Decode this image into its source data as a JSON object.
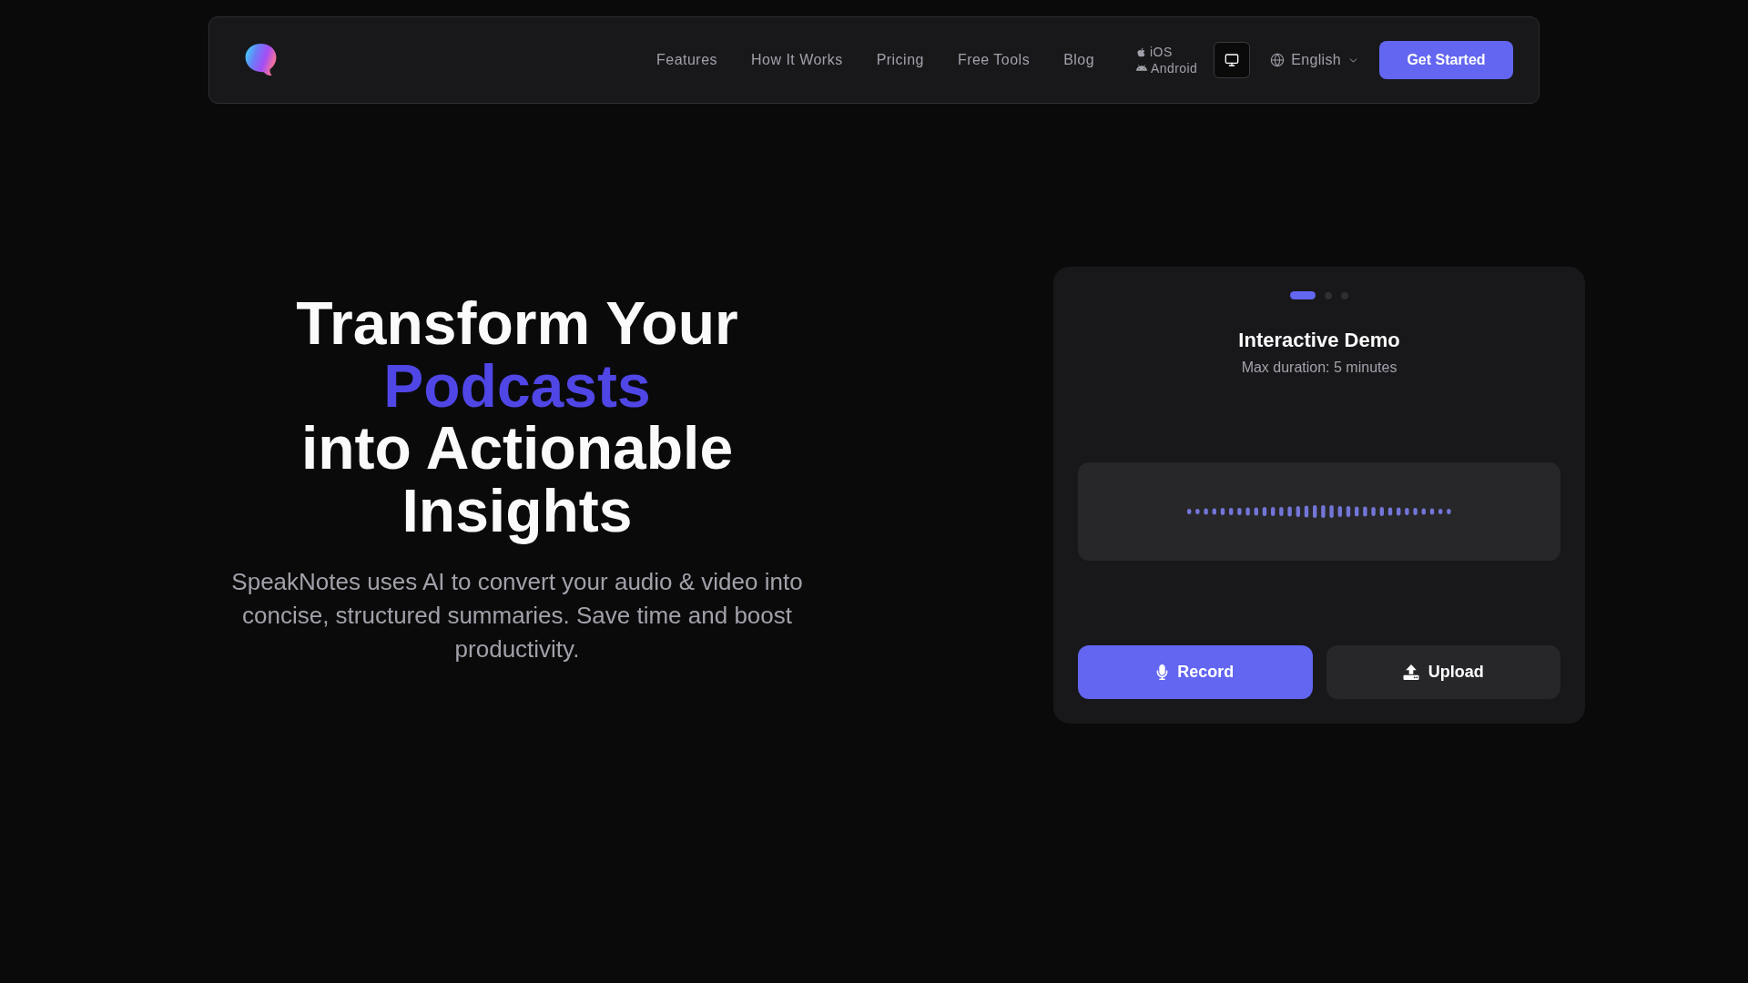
{
  "nav": {
    "links": [
      {
        "label": "Features"
      },
      {
        "label": "How It Works"
      },
      {
        "label": "Pricing"
      },
      {
        "label": "Free Tools"
      },
      {
        "label": "Blog"
      }
    ],
    "platforms": [
      {
        "kind": "apple",
        "label": "iOS"
      },
      {
        "kind": "android",
        "label": "Android"
      }
    ],
    "language": {
      "label": "English"
    },
    "cta": {
      "label": "Get Started"
    }
  },
  "hero": {
    "headline": [
      {
        "text": "Transform Your",
        "highlight": false
      },
      {
        "text": "Podcasts",
        "highlight": true
      },
      {
        "text": "into Actionable",
        "highlight": false
      },
      {
        "text": "Insights",
        "highlight": false
      }
    ],
    "description": "SpeakNotes uses AI to convert your audio & video into concise, structured summaries. Save time and boost productivity."
  },
  "demo": {
    "slides": [
      {
        "selected": true
      },
      {
        "selected": false
      },
      {
        "selected": false
      }
    ],
    "title": "Interactive Demo",
    "subtitle": "Max duration: 5 minutes",
    "actions": [
      {
        "kind": "record",
        "label": "Record"
      },
      {
        "kind": "upload",
        "label": "Upload"
      }
    ]
  }
}
